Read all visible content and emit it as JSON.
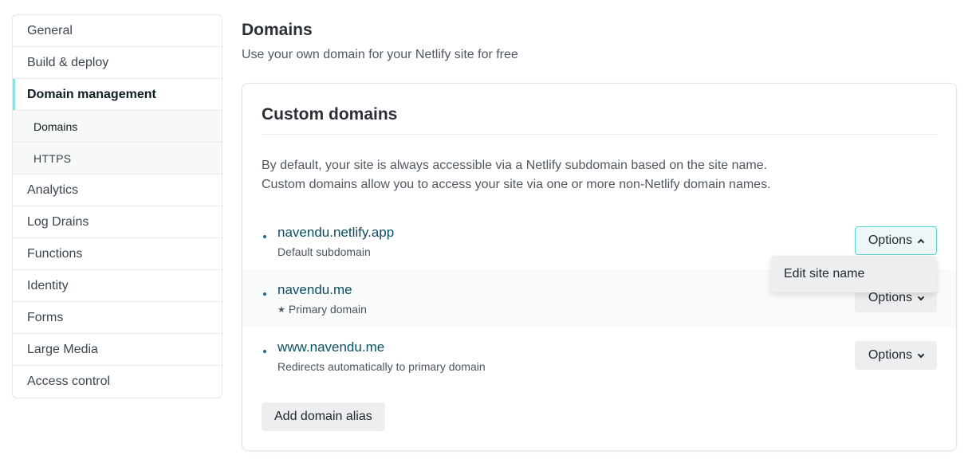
{
  "sidebar": {
    "items": [
      {
        "label": "General"
      },
      {
        "label": "Build & deploy"
      },
      {
        "label": "Domain management"
      },
      {
        "label": "Domains"
      },
      {
        "label": "HTTPS"
      },
      {
        "label": "Analytics"
      },
      {
        "label": "Log Drains"
      },
      {
        "label": "Functions"
      },
      {
        "label": "Identity"
      },
      {
        "label": "Forms"
      },
      {
        "label": "Large Media"
      },
      {
        "label": "Access control"
      }
    ]
  },
  "page": {
    "title": "Domains",
    "subtitle": "Use your own domain for your Netlify site for free"
  },
  "custom_domains": {
    "title": "Custom domains",
    "desc_line1": "By default, your site is always accessible via a Netlify subdomain based on the site name.",
    "desc_line2": "Custom domains allow you to access your site via one or more non-Netlify domain names.",
    "domains": [
      {
        "name": "navendu.netlify.app",
        "note": "Default subdomain",
        "options_label": "Options"
      },
      {
        "name": "navendu.me",
        "note": "Primary domain",
        "options_label": "Options",
        "icon": "star-icon"
      },
      {
        "name": "www.navendu.me",
        "note": "Redirects automatically to primary domain",
        "options_label": "Options"
      }
    ],
    "dropdown_item": "Edit site name",
    "add_label": "Add domain alias"
  },
  "colors": {
    "accent": "#5bd6cf",
    "link": "#0b4f63"
  }
}
